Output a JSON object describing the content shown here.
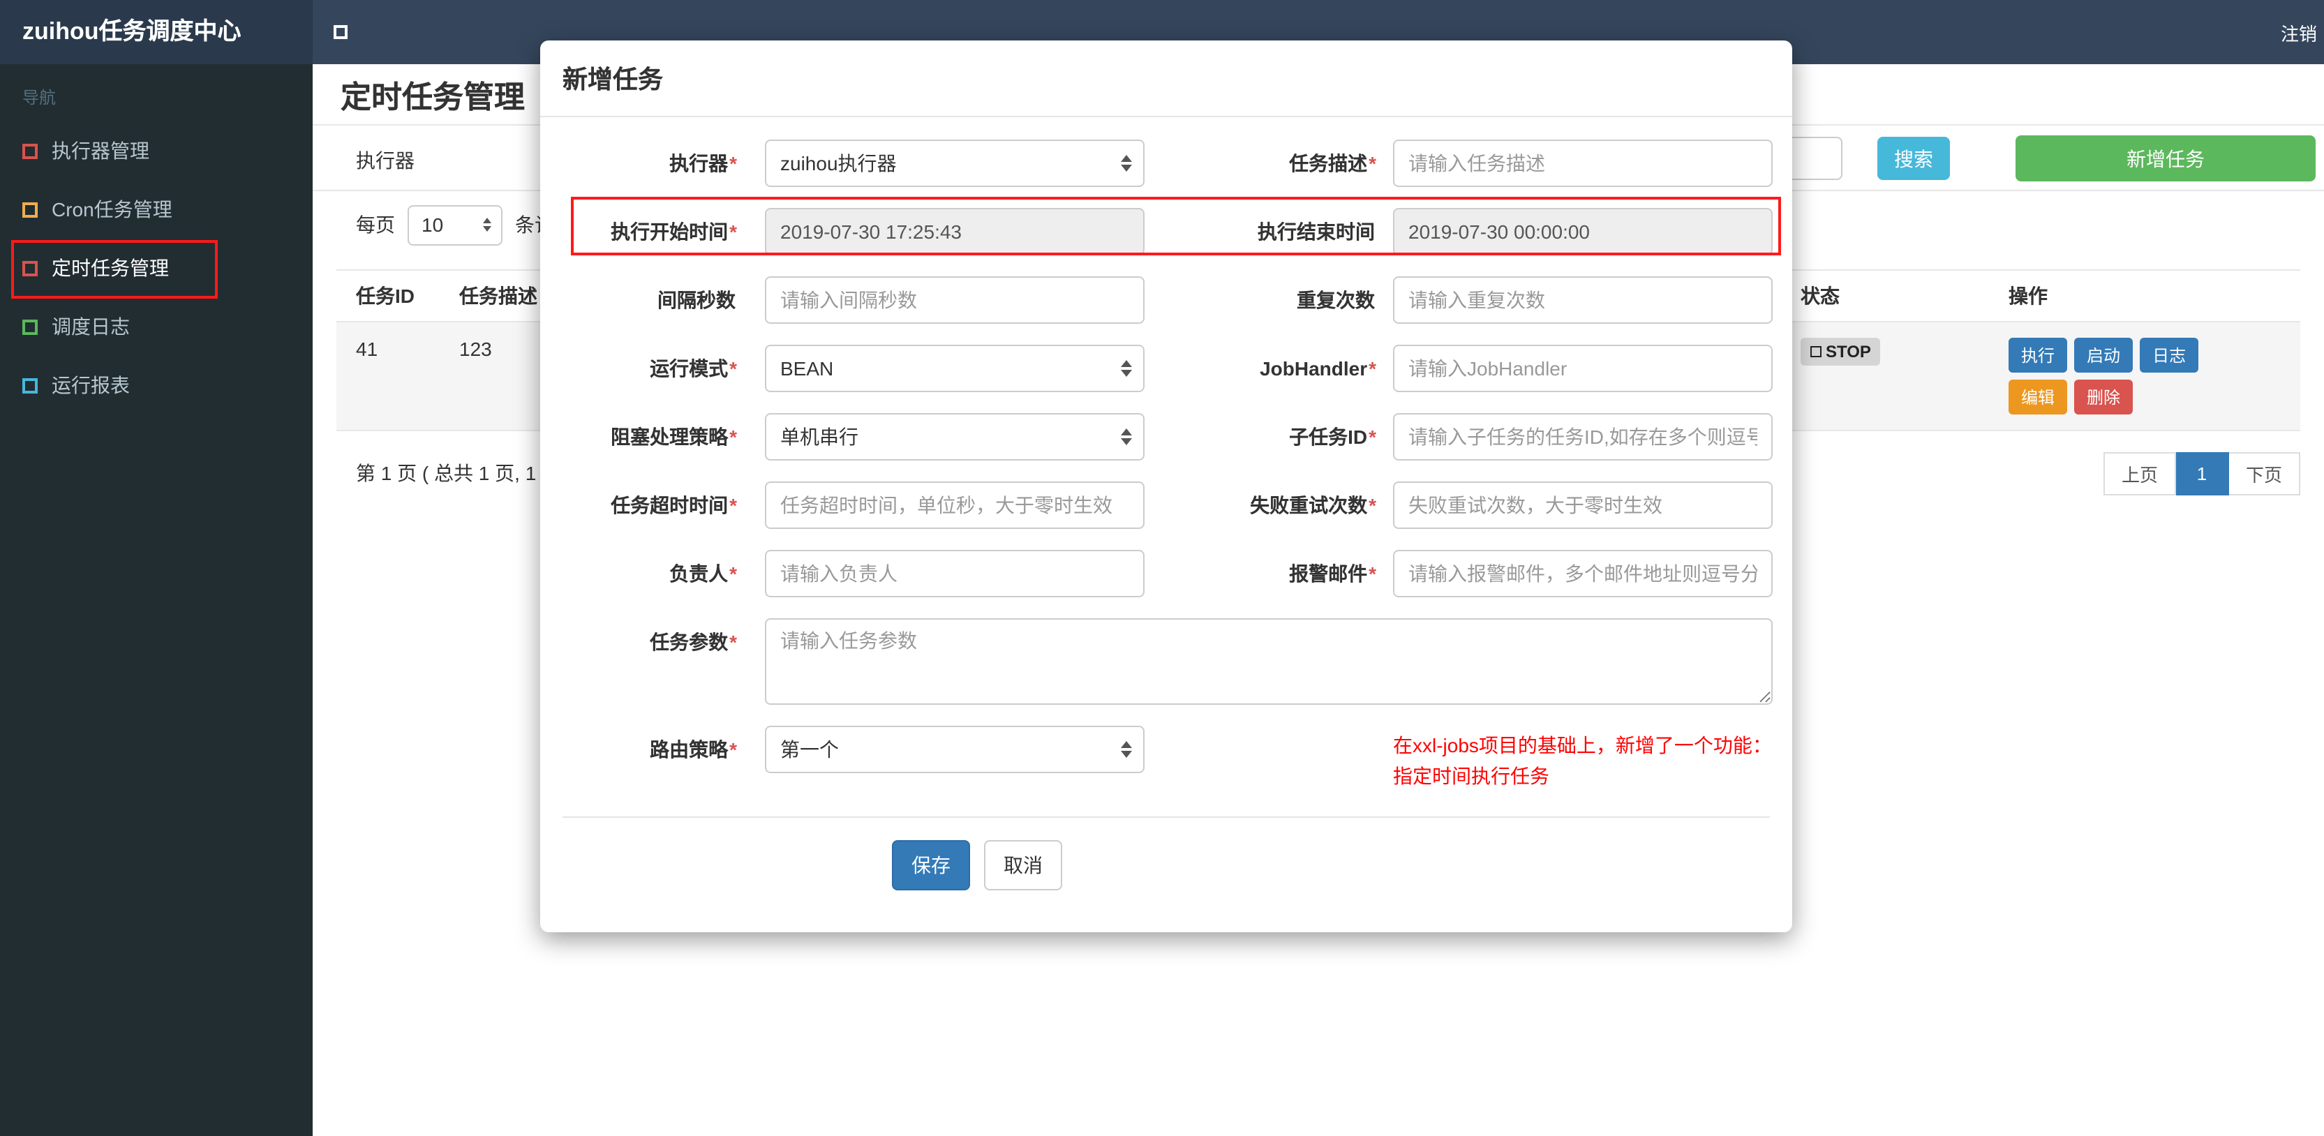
{
  "colors": {
    "topbar_bg": "#35465c",
    "brand_bg": "#2a3a4c",
    "sidebar_bg": "#222d32",
    "primary": "#337ab7",
    "info": "#46b8da",
    "success": "#5cb85c",
    "warning": "#ec971f",
    "danger": "#d9534f",
    "annotation_red": "#ff1a1a"
  },
  "topbar": {
    "brand": "zuihou任务调度中心",
    "logout": "注销"
  },
  "sidebar": {
    "nav_header": "导航",
    "items": [
      {
        "key": "executor-manage",
        "label": "执行器管理",
        "icon_color": "#d9534f",
        "active": false
      },
      {
        "key": "cron-task",
        "label": "Cron任务管理",
        "icon_color": "#f0ad4e",
        "active": false
      },
      {
        "key": "timed-task",
        "label": "定时任务管理",
        "icon_color": "#d9534f",
        "active": true
      },
      {
        "key": "schedule-log",
        "label": "调度日志",
        "icon_color": "#5cb85c",
        "active": false
      },
      {
        "key": "run-report",
        "label": "运行报表",
        "icon_color": "#46b8da",
        "active": false
      }
    ]
  },
  "page": {
    "title": "定时任务管理",
    "filter_label": "执行器",
    "search_button": "搜索",
    "add_button": "新增任务",
    "perpage_prefix": "每页",
    "perpage_value": "10",
    "perpage_suffix": "条记录"
  },
  "table": {
    "headers": {
      "id": "任务ID",
      "desc": "任务描述",
      "status": "状态",
      "action": "操作"
    },
    "row": {
      "id": "41",
      "desc": "123",
      "status": "STOP"
    },
    "actions": [
      {
        "label": "执行",
        "style": "primary"
      },
      {
        "label": "启动",
        "style": "primary"
      },
      {
        "label": "日志",
        "style": "primary"
      },
      {
        "label": "编辑",
        "style": "warning"
      },
      {
        "label": "删除",
        "style": "danger"
      }
    ],
    "summary": "第 1 页 ( 总共 1 页, 1",
    "pager": {
      "prev": "上页",
      "current": "1",
      "next": "下页"
    }
  },
  "modal": {
    "title": "新增任务",
    "fields": {
      "executor": {
        "label": "执行器",
        "required": true,
        "value": "zuihou执行器"
      },
      "desc": {
        "label": "任务描述",
        "required": true,
        "placeholder": "请输入任务描述"
      },
      "start": {
        "label": "执行开始时间",
        "required": true,
        "value": "2019-07-30 17:25:43"
      },
      "end": {
        "label": "执行结束时间",
        "required": false,
        "value": "2019-07-30 00:00:00"
      },
      "interval": {
        "label": "间隔秒数",
        "required": false,
        "placeholder": "请输入间隔秒数"
      },
      "repeat": {
        "label": "重复次数",
        "required": false,
        "placeholder": "请输入重复次数"
      },
      "mode": {
        "label": "运行模式",
        "required": true,
        "value": "BEAN"
      },
      "handler": {
        "label": "JobHandler",
        "required": true,
        "placeholder": "请输入JobHandler"
      },
      "block": {
        "label": "阻塞处理策略",
        "required": true,
        "value": "单机串行"
      },
      "child": {
        "label": "子任务ID",
        "required": true,
        "placeholder": "请输入子任务的任务ID,如存在多个则逗号分隔"
      },
      "timeout": {
        "label": "任务超时时间",
        "required": true,
        "placeholder": "任务超时时间，单位秒，大于零时生效"
      },
      "retry": {
        "label": "失败重试次数",
        "required": true,
        "placeholder": "失败重试次数，大于零时生效"
      },
      "owner": {
        "label": "负责人",
        "required": true,
        "placeholder": "请输入负责人"
      },
      "email": {
        "label": "报警邮件",
        "required": true,
        "placeholder": "请输入报警邮件，多个邮件地址则逗号分隔"
      },
      "params": {
        "label": "任务参数",
        "required": true,
        "placeholder": "请输入任务参数"
      },
      "route": {
        "label": "路由策略",
        "required": true,
        "value": "第一个"
      }
    },
    "note_line1": "在xxl-jobs项目的基础上，新增了一个功能：",
    "note_line2": "指定时间执行任务",
    "save": "保存",
    "cancel": "取消"
  }
}
